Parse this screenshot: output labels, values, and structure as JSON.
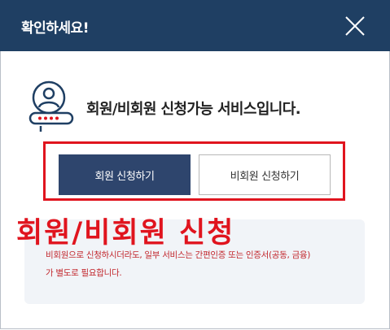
{
  "dialog": {
    "title": "확인하세요!",
    "close_icon": "close-icon"
  },
  "intro": {
    "icon": "member-id-icon",
    "text": "회원/비회원 신청가능 서비스입니다."
  },
  "buttons": {
    "member_label": "회원 신청하기",
    "guest_label": "비회원 신청하기"
  },
  "annotation": {
    "caption": "회원/비회원 신청",
    "color": "#e0141e"
  },
  "notice": {
    "line1": "비회원으로 신청하시더라도, 일부 서비스는 간편인증 또는 인증서(공동, 금융)",
    "line2": "가 별도로 필요합니다."
  },
  "colors": {
    "header_bg": "#1f3f63",
    "primary_button": "#2e456d",
    "notice_bg": "#f1f4f8",
    "notice_text": "#c2272d"
  }
}
